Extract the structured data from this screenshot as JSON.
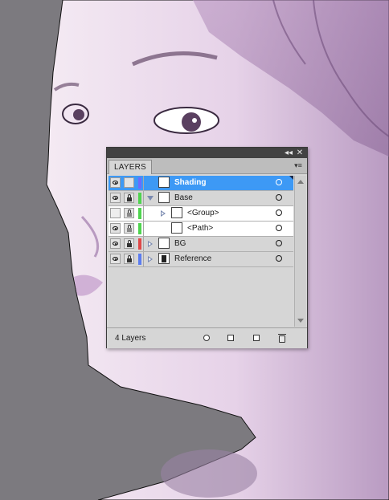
{
  "panel": {
    "tab_label": "LAYERS",
    "collapse_glyph": "◂◂",
    "close_glyph": "✕",
    "menu_glyph": "▾≡",
    "layer_count": "4 Layers"
  },
  "layers": [
    {
      "name": "Shading",
      "visible": true,
      "locked": false,
      "color": "#6b6bff",
      "expand": "none",
      "selected": true
    },
    {
      "name": "Base",
      "visible": true,
      "locked": true,
      "color": "#4fd44f",
      "expand": "down",
      "selected": false
    },
    {
      "name": "<Group>",
      "visible": false,
      "locked": true,
      "color": "#4fd44f",
      "expand": "right",
      "selected": false
    },
    {
      "name": "<Path>",
      "visible": true,
      "locked": true,
      "color": "#4fd44f",
      "expand": "none",
      "selected": false
    },
    {
      "name": "BG",
      "visible": true,
      "locked": true,
      "color": "#e04848",
      "expand": "right",
      "selected": false
    },
    {
      "name": "Reference",
      "visible": true,
      "locked": true,
      "color": "#5b7cf0",
      "expand": "right",
      "selected": false
    }
  ],
  "footer_buttons": [
    "locate-object-icon",
    "make-clipping-mask-icon",
    "new-sublayer-icon",
    "new-layer-icon",
    "delete-layer-icon"
  ],
  "colors": {
    "selection": "#3d99f5",
    "canvas_gray": "#7c7a7f",
    "photo_tint": "#d8c0dc"
  }
}
